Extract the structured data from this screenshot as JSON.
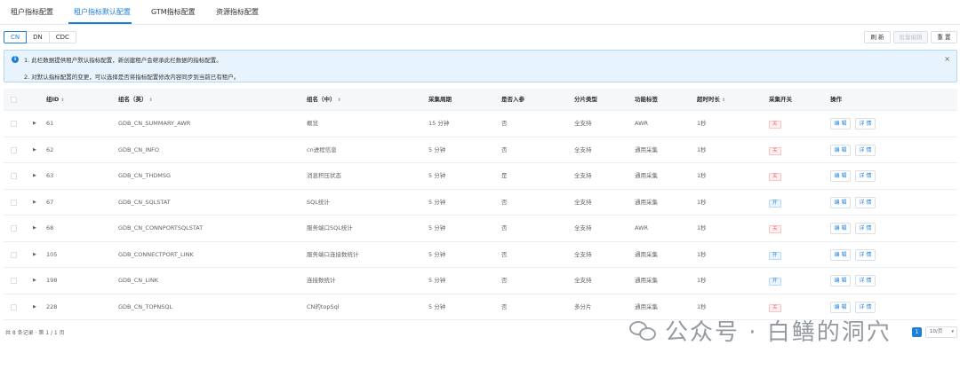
{
  "tabs": [
    {
      "label": "租户指标配置",
      "active": false
    },
    {
      "label": "租户指标默认配置",
      "active": true
    },
    {
      "label": "GTM指标配置",
      "active": false
    },
    {
      "label": "资源指标配置",
      "active": false
    }
  ],
  "regions": [
    {
      "label": "CN",
      "active": true
    },
    {
      "label": "DN",
      "active": false
    },
    {
      "label": "CDC",
      "active": false
    }
  ],
  "toolbar": {
    "refresh_label": "刷 新",
    "batch_edit_label": "批量编辑",
    "reset_label": "重 置"
  },
  "alert": {
    "icon": "info-icon",
    "line1": "1. 此栏数据提供租户默认指标配置，新创建租户会继承此栏数据的指标配置。",
    "line2": "2. 对默认指标配置的变更，可以选择是否将指标配置修改内容同步到当前已有租户。",
    "close": "×"
  },
  "columns": {
    "group_id": "组ID",
    "name_en": "组名（英）",
    "name_cn": "组名（中）",
    "period": "采集周期",
    "storage": "是否入参",
    "shard": "分片类型",
    "func_tag": "功能标签",
    "timeout": "超时时长",
    "switch": "采集开关",
    "ops": "操作"
  },
  "rows": [
    {
      "id": "61",
      "name_en": "GDB_CN_SUMMARY_AWR",
      "name_cn": "概览",
      "period": "15 分钟",
      "storage": "否",
      "shard": "全支持",
      "func_tag": "AWR",
      "timeout": "1秒",
      "switch": "关",
      "switch_on": false
    },
    {
      "id": "62",
      "name_en": "GDB_CN_INFO",
      "name_cn": "cn进程信息",
      "period": "5 分钟",
      "storage": "否",
      "shard": "全支持",
      "func_tag": "通用采集",
      "timeout": "1秒",
      "switch": "关",
      "switch_on": false
    },
    {
      "id": "63",
      "name_en": "GDB_CN_THDMSG",
      "name_cn": "消息积压状态",
      "period": "5 分钟",
      "storage": "是",
      "shard": "全支持",
      "func_tag": "通用采集",
      "timeout": "1秒",
      "switch": "关",
      "switch_on": false
    },
    {
      "id": "67",
      "name_en": "GDB_CN_SQLSTAT",
      "name_cn": "SQL统计",
      "period": "5 分钟",
      "storage": "否",
      "shard": "全支持",
      "func_tag": "通用采集",
      "timeout": "1秒",
      "switch": "开",
      "switch_on": true
    },
    {
      "id": "68",
      "name_en": "GDB_CN_CONNPORTSQLSTAT",
      "name_cn": "服务端口SQL统计",
      "period": "5 分钟",
      "storage": "否",
      "shard": "全支持",
      "func_tag": "AWR",
      "timeout": "1秒",
      "switch": "关",
      "switch_on": false
    },
    {
      "id": "105",
      "name_en": "GDB_CONNECTPORT_LINK",
      "name_cn": "服务端口连接数统计",
      "period": "5 分钟",
      "storage": "否",
      "shard": "全支持",
      "func_tag": "通用采集",
      "timeout": "1秒",
      "switch": "开",
      "switch_on": true
    },
    {
      "id": "198",
      "name_en": "GDB_CN_LINK",
      "name_cn": "连接数统计",
      "period": "5 分钟",
      "storage": "否",
      "shard": "全支持",
      "func_tag": "通用采集",
      "timeout": "1秒",
      "switch": "开",
      "switch_on": true
    },
    {
      "id": "228",
      "name_en": "GDB_CN_TOPNSQL",
      "name_cn": "CN的topSql",
      "period": "5 分钟",
      "storage": "否",
      "shard": "多分片",
      "func_tag": "通用采集",
      "timeout": "1秒",
      "switch": "关",
      "switch_on": false
    }
  ],
  "row_actions": {
    "edit": "编 辑",
    "detail": "详 情"
  },
  "footer": {
    "summary": "共 8 条记录 · 第 1 / 1 页",
    "current_page": "1",
    "page_size": "10/页"
  },
  "watermark": {
    "text": "公众号 · 白鳝的洞穴",
    "icon": "wechat-icon"
  },
  "colors": {
    "accent": "#1e7fd9",
    "danger": "#f56c6c",
    "alert_bg": "#e8f4fd"
  }
}
